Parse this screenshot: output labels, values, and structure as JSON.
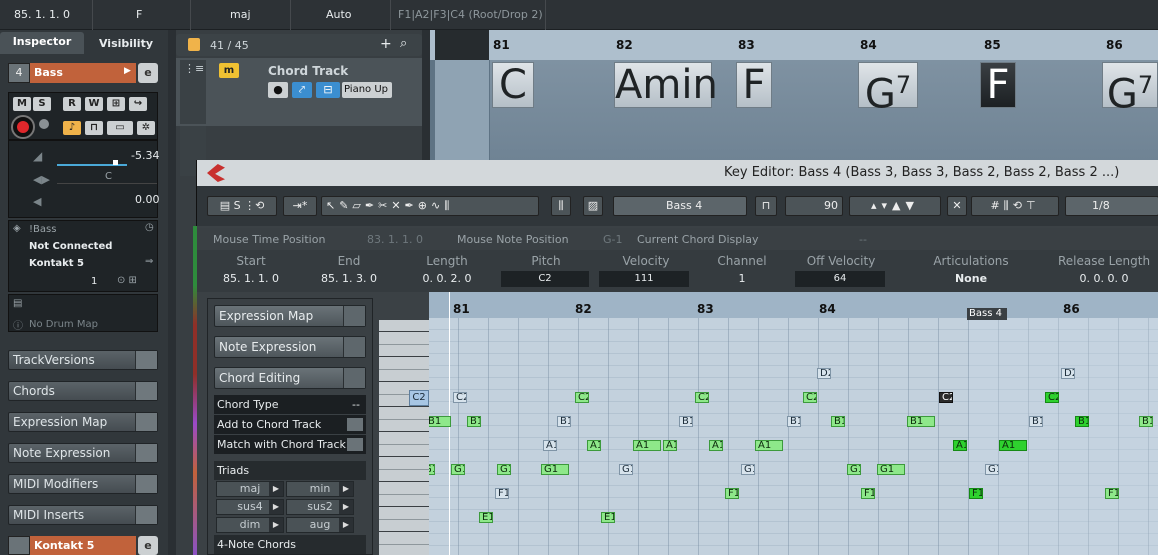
{
  "topbar": {
    "position": "85. 1. 1.   0",
    "root": "F",
    "type": "maj",
    "tension": "Auto",
    "voicing": "F1|A2|F3|C4 (Root/Drop 2)"
  },
  "inspector": {
    "tab_inspector": "Inspector",
    "tab_visibility": "Visibility",
    "track_name": "Bass",
    "track_number": "4",
    "volume_value": "-5.34",
    "pan_value": "C",
    "delay_value": "0.00",
    "input_routing": "!Bass",
    "input_status": "Not Connected",
    "output_routing": "Kontakt 5",
    "channel": "1",
    "drum_map": "No Drum Map",
    "sections": [
      "TrackVersions",
      "Chords",
      "Expression Map",
      "Note Expression",
      "MIDI Modifiers",
      "MIDI Inserts"
    ],
    "bottom_track": "Kontakt 5"
  },
  "tracklist": {
    "count": "41 / 45",
    "chord_track_name": "Chord Track",
    "mute_label": "M",
    "voicing_button": "Piano Up"
  },
  "project_ruler": {
    "bars": [
      "81",
      "82",
      "83",
      "84",
      "85",
      "86"
    ],
    "chords": [
      {
        "root": "C",
        "suffix": ""
      },
      {
        "root": "Amin",
        "suffix": ""
      },
      {
        "root": "F",
        "suffix": ""
      },
      {
        "root": "G",
        "suffix": "7"
      },
      {
        "root": "F",
        "suffix": ""
      },
      {
        "root": "G",
        "suffix": "7"
      }
    ]
  },
  "key_editor": {
    "title": "Key Editor: Bass 4 (Bass 3, Bass 3, Bass 2, Bass 2, Bass 2 ...)",
    "track_select": "Bass 4",
    "velocity_value": "90",
    "quantize_value": "1/8",
    "infobar": {
      "mouse_time_label": "Mouse Time Position",
      "mouse_time_value": "83. 1. 1.   0",
      "mouse_note_label": "Mouse Note Position",
      "mouse_note_value": "G-1",
      "chord_display_label": "Current Chord Display",
      "chord_display_value": "--"
    },
    "infoline": {
      "headers": [
        "Start",
        "End",
        "Length",
        "Pitch",
        "Velocity",
        "Channel",
        "Off Velocity",
        "Articulations",
        "Release Length"
      ],
      "values": [
        "85. 1. 1.   0",
        "85. 1. 3.   0",
        "0. 0. 2.   0",
        "C2",
        "111",
        "1",
        "64",
        "None",
        "0. 0. 0.   0"
      ]
    },
    "left_panel": {
      "expression_map": "Expression Map",
      "note_expression": "Note Expression",
      "chord_editing": "Chord Editing",
      "chord_type_label": "Chord Type",
      "chord_type_value": "--",
      "add_to_chord_track": "Add to Chord Track",
      "match_with_chord_track": "Match with Chord Track",
      "triads_label": "Triads",
      "triads": [
        "maj",
        "min",
        "sus4",
        "sus2",
        "dim",
        "aug"
      ],
      "four_note_label": "4-Note Chords"
    },
    "grid_ruler": {
      "bars": [
        "81",
        "82",
        "83",
        "84",
        "86"
      ],
      "part_label": "Bass 4"
    },
    "key_label": "C2",
    "notes": [
      {
        "label": "D2"
      },
      {
        "label": "D2"
      },
      {
        "label": "C2"
      },
      {
        "label": "C2"
      },
      {
        "label": "C2"
      },
      {
        "label": "C2"
      },
      {
        "label": "C2"
      },
      {
        "label": "C2"
      },
      {
        "label": "B1"
      },
      {
        "label": "B1"
      },
      {
        "label": "B1"
      },
      {
        "label": "B1"
      },
      {
        "label": "B1"
      },
      {
        "label": "B1"
      },
      {
        "label": "B1"
      },
      {
        "label": "B1"
      },
      {
        "label": "B1"
      },
      {
        "label": "B1"
      },
      {
        "label": "A1"
      },
      {
        "label": "A1"
      },
      {
        "label": "A1"
      },
      {
        "label": "A1"
      },
      {
        "label": "A1"
      },
      {
        "label": "A1"
      },
      {
        "label": "A1"
      },
      {
        "label": "A1"
      },
      {
        "label": "G1"
      },
      {
        "label": "G1"
      },
      {
        "label": "G1"
      },
      {
        "label": "G1"
      },
      {
        "label": "G1"
      },
      {
        "label": "G1"
      },
      {
        "label": "G1"
      },
      {
        "label": "G1"
      },
      {
        "label": "G1"
      },
      {
        "label": "F1"
      },
      {
        "label": "F1"
      },
      {
        "label": "F1"
      },
      {
        "label": "F1"
      },
      {
        "label": "F1"
      },
      {
        "label": "E1"
      },
      {
        "label": "E1"
      }
    ]
  },
  "colors": {
    "accent_orange": "#c1623b",
    "note_green": "#8ee88a",
    "note_selected": "#2ed12e",
    "record_red": "#e0272b"
  }
}
